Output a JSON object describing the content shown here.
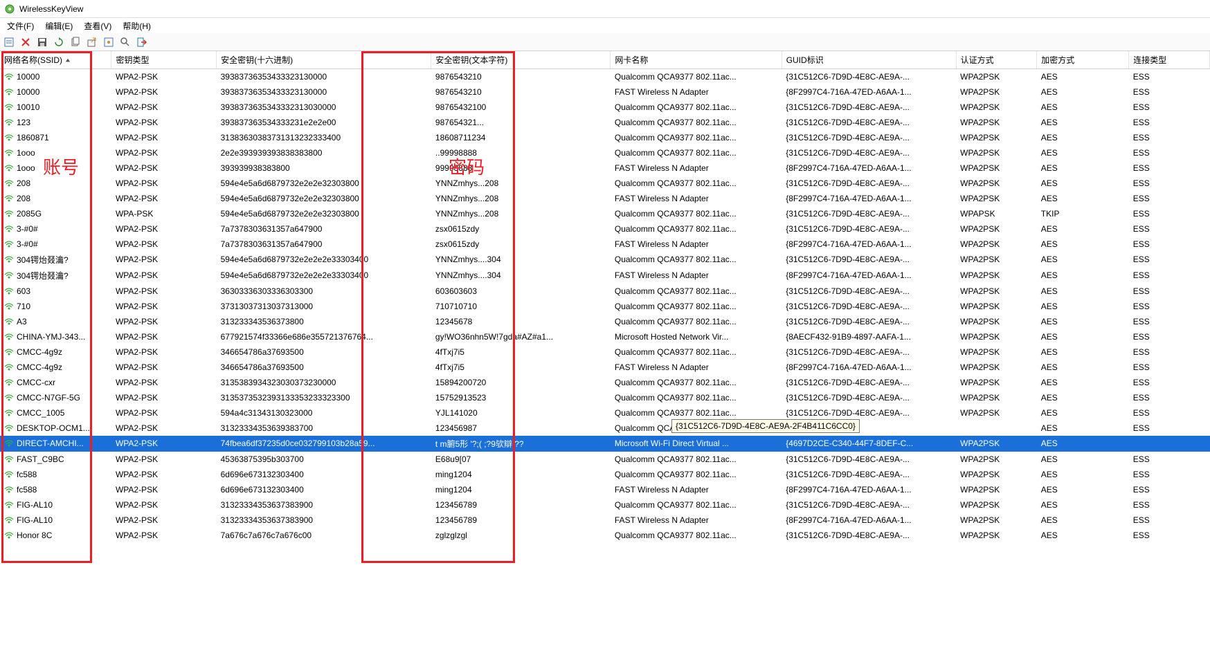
{
  "title": "WirelessKeyView",
  "menus": [
    "文件(F)",
    "编辑(E)",
    "查看(V)",
    "帮助(H)"
  ],
  "columns": [
    {
      "label": "网络名称(SSID)",
      "cls": "col-ssid",
      "sorted": true
    },
    {
      "label": "密钥类型",
      "cls": "col-keytype"
    },
    {
      "label": "安全密钥(十六进制)",
      "cls": "col-hex"
    },
    {
      "label": "安全密钥(文本字符)",
      "cls": "col-ascii"
    },
    {
      "label": "网卡名称",
      "cls": "col-adapter"
    },
    {
      "label": "GUID标识",
      "cls": "col-guid"
    },
    {
      "label": "认证方式",
      "cls": "col-auth"
    },
    {
      "label": "加密方式",
      "cls": "col-enc"
    },
    {
      "label": "连接类型",
      "cls": "col-conn"
    }
  ],
  "annotations": {
    "account_label": "账号",
    "password_label": "密码"
  },
  "tooltip": {
    "text": "{31C512C6-7D9D-4E8C-AE9A-2F4B411C6CC0}",
    "row": 23,
    "col": 5
  },
  "selected_row": 24,
  "rows": [
    {
      "ssid": "10000",
      "keytype": "WPA2-PSK",
      "hex": "39383736353433323130000",
      "ascii": "9876543210",
      "adapter": "Qualcomm QCA9377 802.11ac...",
      "guid": "{31C512C6-7D9D-4E8C-AE9A-...",
      "auth": "WPA2PSK",
      "enc": "AES",
      "conn": "ESS"
    },
    {
      "ssid": "10000",
      "keytype": "WPA2-PSK",
      "hex": "39383736353433323130000",
      "ascii": "9876543210",
      "adapter": "FAST Wireless N Adapter",
      "guid": "{8F2997C4-716A-47ED-A6AA-1...",
      "auth": "WPA2PSK",
      "enc": "AES",
      "conn": "ESS"
    },
    {
      "ssid": "10010",
      "keytype": "WPA2-PSK",
      "hex": "3938373635343332313030000",
      "ascii": "98765432100",
      "adapter": "Qualcomm QCA9377 802.11ac...",
      "guid": "{31C512C6-7D9D-4E8C-AE9A-...",
      "auth": "WPA2PSK",
      "enc": "AES",
      "conn": "ESS"
    },
    {
      "ssid": "123",
      "keytype": "WPA2-PSK",
      "hex": "393837363534333231e2e2e00",
      "ascii": "987654321...",
      "adapter": "Qualcomm QCA9377 802.11ac...",
      "guid": "{31C512C6-7D9D-4E8C-AE9A-...",
      "auth": "WPA2PSK",
      "enc": "AES",
      "conn": "ESS"
    },
    {
      "ssid": "1860871",
      "keytype": "WPA2-PSK",
      "hex": "31383630383731313232333400",
      "ascii": "18608711234",
      "adapter": "Qualcomm QCA9377 802.11ac...",
      "guid": "{31C512C6-7D9D-4E8C-AE9A-...",
      "auth": "WPA2PSK",
      "enc": "AES",
      "conn": "ESS"
    },
    {
      "ssid": "1ooo",
      "keytype": "WPA2-PSK",
      "hex": "2e2e393939393838383800",
      "ascii": "..99998888",
      "adapter": "Qualcomm QCA9377 802.11ac...",
      "guid": "{31C512C6-7D9D-4E8C-AE9A-...",
      "auth": "WPA2PSK",
      "enc": "AES",
      "conn": "ESS"
    },
    {
      "ssid": "1ooo",
      "keytype": "WPA2-PSK",
      "hex": "393939938383800",
      "ascii": "99998888",
      "adapter": "FAST Wireless N Adapter",
      "guid": "{8F2997C4-716A-47ED-A6AA-1...",
      "auth": "WPA2PSK",
      "enc": "AES",
      "conn": "ESS"
    },
    {
      "ssid": "208",
      "keytype": "WPA2-PSK",
      "hex": "594e4e5a6d6879732e2e2e32303800",
      "ascii": "YNNZmhys...208",
      "adapter": "Qualcomm QCA9377 802.11ac...",
      "guid": "{31C512C6-7D9D-4E8C-AE9A-...",
      "auth": "WPA2PSK",
      "enc": "AES",
      "conn": "ESS"
    },
    {
      "ssid": "208",
      "keytype": "WPA2-PSK",
      "hex": "594e4e5a6d6879732e2e2e32303800",
      "ascii": "YNNZmhys...208",
      "adapter": "FAST Wireless N Adapter",
      "guid": "{8F2997C4-716A-47ED-A6AA-1...",
      "auth": "WPA2PSK",
      "enc": "AES",
      "conn": "ESS"
    },
    {
      "ssid": "2085G",
      "keytype": "WPA-PSK",
      "hex": "594e4e5a6d6879732e2e2e32303800",
      "ascii": "YNNZmhys...208",
      "adapter": "Qualcomm QCA9377 802.11ac...",
      "guid": "{31C512C6-7D9D-4E8C-AE9A-...",
      "auth": "WPAPSK",
      "enc": "TKIP",
      "conn": "ESS"
    },
    {
      "ssid": "3-#0#",
      "keytype": "WPA2-PSK",
      "hex": "7a7378303631357a647900",
      "ascii": "zsx0615zdy",
      "adapter": "Qualcomm QCA9377 802.11ac...",
      "guid": "{31C512C6-7D9D-4E8C-AE9A-...",
      "auth": "WPA2PSK",
      "enc": "AES",
      "conn": "ESS"
    },
    {
      "ssid": "3-#0#",
      "keytype": "WPA2-PSK",
      "hex": "7a7378303631357a647900",
      "ascii": "zsx0615zdy",
      "adapter": "FAST Wireless N Adapter",
      "guid": "{8F2997C4-716A-47ED-A6AA-1...",
      "auth": "WPA2PSK",
      "enc": "AES",
      "conn": "ESS"
    },
    {
      "ssid": "304锷炲叕瀹?",
      "keytype": "WPA2-PSK",
      "hex": "594e4e5a6d6879732e2e2e2e33303400",
      "ascii": "YNNZmhys....304",
      "adapter": "Qualcomm QCA9377 802.11ac...",
      "guid": "{31C512C6-7D9D-4E8C-AE9A-...",
      "auth": "WPA2PSK",
      "enc": "AES",
      "conn": "ESS"
    },
    {
      "ssid": "304锷炲叕瀹?",
      "keytype": "WPA2-PSK",
      "hex": "594e4e5a6d6879732e2e2e2e33303400",
      "ascii": "YNNZmhys....304",
      "adapter": "FAST Wireless N Adapter",
      "guid": "{8F2997C4-716A-47ED-A6AA-1...",
      "auth": "WPA2PSK",
      "enc": "AES",
      "conn": "ESS"
    },
    {
      "ssid": "603",
      "keytype": "WPA2-PSK",
      "hex": "36303336303336303300",
      "ascii": "603603603",
      "adapter": "Qualcomm QCA9377 802.11ac...",
      "guid": "{31C512C6-7D9D-4E8C-AE9A-...",
      "auth": "WPA2PSK",
      "enc": "AES",
      "conn": "ESS"
    },
    {
      "ssid": "710",
      "keytype": "WPA2-PSK",
      "hex": "37313037313037313000",
      "ascii": "710710710",
      "adapter": "Qualcomm QCA9377 802.11ac...",
      "guid": "{31C512C6-7D9D-4E8C-AE9A-...",
      "auth": "WPA2PSK",
      "enc": "AES",
      "conn": "ESS"
    },
    {
      "ssid": "A3",
      "keytype": "WPA2-PSK",
      "hex": "313233343536373800",
      "ascii": "12345678",
      "adapter": "Qualcomm QCA9377 802.11ac...",
      "guid": "{31C512C6-7D9D-4E8C-AE9A-...",
      "auth": "WPA2PSK",
      "enc": "AES",
      "conn": "ESS"
    },
    {
      "ssid": "CHINA-YMJ-343...",
      "keytype": "WPA2-PSK",
      "hex": "677921574f33366e686e355721376764...",
      "ascii": "gy!WO36nhn5W!7gda#AZ#a1...",
      "adapter": "Microsoft Hosted Network Vir...",
      "guid": "{8AECF432-91B9-4897-AAFA-1...",
      "auth": "WPA2PSK",
      "enc": "AES",
      "conn": "ESS"
    },
    {
      "ssid": "CMCC-4g9z",
      "keytype": "WPA2-PSK",
      "hex": "346654786a37693500",
      "ascii": "4fTxj7i5",
      "adapter": "Qualcomm QCA9377 802.11ac...",
      "guid": "{31C512C6-7D9D-4E8C-AE9A-...",
      "auth": "WPA2PSK",
      "enc": "AES",
      "conn": "ESS"
    },
    {
      "ssid": "CMCC-4g9z",
      "keytype": "WPA2-PSK",
      "hex": "346654786a37693500",
      "ascii": "4fTxj7i5",
      "adapter": "FAST Wireless N Adapter",
      "guid": "{8F2997C4-716A-47ED-A6AA-1...",
      "auth": "WPA2PSK",
      "enc": "AES",
      "conn": "ESS"
    },
    {
      "ssid": "CMCC-cxr",
      "keytype": "WPA2-PSK",
      "hex": "3135383934323030373230000",
      "ascii": "15894200720",
      "adapter": "Qualcomm QCA9377 802.11ac...",
      "guid": "{31C512C6-7D9D-4E8C-AE9A-...",
      "auth": "WPA2PSK",
      "enc": "AES",
      "conn": "ESS"
    },
    {
      "ssid": "CMCC-N7GF-5G",
      "keytype": "WPA2-PSK",
      "hex": "3135373532393133353233323300",
      "ascii": "15752913523",
      "adapter": "Qualcomm QCA9377 802.11ac...",
      "guid": "{31C512C6-7D9D-4E8C-AE9A-...",
      "auth": "WPA2PSK",
      "enc": "AES",
      "conn": "ESS"
    },
    {
      "ssid": "CMCC_1005",
      "keytype": "WPA2-PSK",
      "hex": "594a4c31343130323000",
      "ascii": "YJL141020",
      "adapter": "Qualcomm QCA9377 802.11ac...",
      "guid": "{31C512C6-7D9D-4E8C-AE9A-...",
      "auth": "WPA2PSK",
      "enc": "AES",
      "conn": "ESS"
    },
    {
      "ssid": "DESKTOP-OCM1...",
      "keytype": "WPA2-PSK",
      "hex": "31323334353639383700",
      "ascii": "123456987",
      "adapter": "Qualcomm QCA9377 802.11ac...",
      "guid": "",
      "auth": "",
      "enc": "AES",
      "conn": "ESS"
    },
    {
      "ssid": "DIRECT-AMCHI...",
      "keytype": "WPA2-PSK",
      "hex": "74fbea6df37235d0ce032799103b28a59...",
      "ascii": "t   m腑5形 '?;(   ;?9欤辯      ??",
      "adapter": "Microsoft Wi-Fi Direct Virtual ...",
      "guid": "{4697D2CE-C340-44F7-8DEF-C...",
      "auth": "WPA2PSK",
      "enc": "AES",
      "conn": ""
    },
    {
      "ssid": "FAST_C9BC",
      "keytype": "WPA2-PSK",
      "hex": "45363875395b303700",
      "ascii": "E68u9[07",
      "adapter": "Qualcomm QCA9377 802.11ac...",
      "guid": "{31C512C6-7D9D-4E8C-AE9A-...",
      "auth": "WPA2PSK",
      "enc": "AES",
      "conn": "ESS"
    },
    {
      "ssid": "fc588",
      "keytype": "WPA2-PSK",
      "hex": "6d696e673132303400",
      "ascii": "ming1204",
      "adapter": "Qualcomm QCA9377 802.11ac...",
      "guid": "{31C512C6-7D9D-4E8C-AE9A-...",
      "auth": "WPA2PSK",
      "enc": "AES",
      "conn": "ESS"
    },
    {
      "ssid": "fc588",
      "keytype": "WPA2-PSK",
      "hex": "6d696e673132303400",
      "ascii": "ming1204",
      "adapter": "FAST Wireless N Adapter",
      "guid": "{8F2997C4-716A-47ED-A6AA-1...",
      "auth": "WPA2PSK",
      "enc": "AES",
      "conn": "ESS"
    },
    {
      "ssid": "FIG-AL10",
      "keytype": "WPA2-PSK",
      "hex": "31323334353637383900",
      "ascii": "123456789",
      "adapter": "Qualcomm QCA9377 802.11ac...",
      "guid": "{31C512C6-7D9D-4E8C-AE9A-...",
      "auth": "WPA2PSK",
      "enc": "AES",
      "conn": "ESS"
    },
    {
      "ssid": "FIG-AL10",
      "keytype": "WPA2-PSK",
      "hex": "31323334353637383900",
      "ascii": "123456789",
      "adapter": "FAST Wireless N Adapter",
      "guid": "{8F2997C4-716A-47ED-A6AA-1...",
      "auth": "WPA2PSK",
      "enc": "AES",
      "conn": "ESS"
    },
    {
      "ssid": "Honor 8C",
      "keytype": "WPA2-PSK",
      "hex": "7a676c7a676c7a676c00",
      "ascii": "zglzglzgl",
      "adapter": "Qualcomm QCA9377 802.11ac...",
      "guid": "{31C512C6-7D9D-4E8C-AE9A-...",
      "auth": "WPA2PSK",
      "enc": "AES",
      "conn": "ESS"
    }
  ]
}
